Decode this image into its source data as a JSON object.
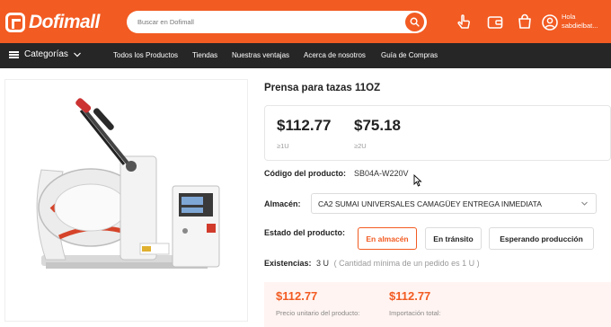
{
  "header": {
    "logo_text": "Dofimall",
    "search_placeholder": "Buscar en Dofimall",
    "greeting_line1": "Hola",
    "greeting_line2": "sabdielbat...",
    "icons": [
      "search-icon",
      "hand-pointer-icon",
      "wallet-icon",
      "cart-icon",
      "user-icon"
    ]
  },
  "nav": {
    "categories_label": "Categorías",
    "items": [
      "Todos los Productos",
      "Tiendas",
      "Nuestras ventajas",
      "Acerca de nosotros",
      "Guía de Compras"
    ]
  },
  "product": {
    "title": "Prensa para tazas 11OZ",
    "prices": [
      {
        "value": "$112.77",
        "tier": "≥1U"
      },
      {
        "value": "$75.18",
        "tier": "≥2U"
      }
    ],
    "code_label": "Código del producto:",
    "code_value": "SB04A-W220V",
    "warehouse_label": "Almacén:",
    "warehouse_value": "CA2 SUMAI UNIVERSALES CAMAGÜEY ENTREGA INMEDIATA",
    "status_label": "Estado del producto:",
    "status_options": [
      {
        "label": "En almacén",
        "selected": true
      },
      {
        "label": "En tránsito",
        "selected": false
      },
      {
        "label": "Esperando producción",
        "selected": false
      }
    ],
    "stock_label": "Existencias:",
    "stock_value": "3 U",
    "stock_note": "( Cantidad mínima de un pedido es 1 U )",
    "unit_price": "$112.77",
    "unit_price_label": "Precio unitario del producto:",
    "import_price": "$112.77",
    "import_label": "Importación total:"
  },
  "colors": {
    "brand": "#f25b22",
    "nav_bg": "#262626"
  }
}
